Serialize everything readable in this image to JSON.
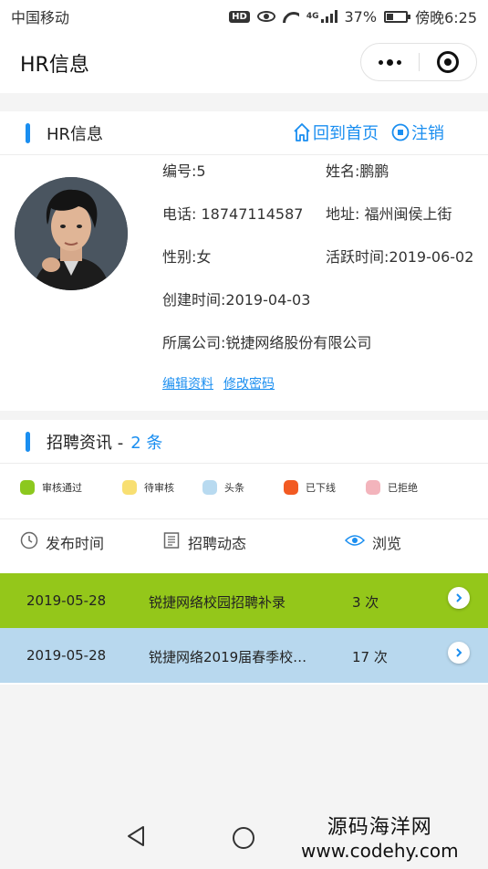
{
  "status_bar": {
    "carrier": "中国移动",
    "hd": "HD",
    "network": "4G",
    "battery": "37%",
    "battery_level": 0.37,
    "time": "傍晚6:25"
  },
  "nav_bar": {
    "title": "HR信息"
  },
  "hr_card": {
    "title": "HR信息",
    "home_action": "回到首页",
    "logout_action": "注销",
    "fields": {
      "id": "编号:5",
      "name": "姓名:鹏鹏",
      "phone": "电话: 18747114587",
      "address": "地址: 福州闽侯上街",
      "gender": "性别:女",
      "active_time": "活跃时间:2019-06-02",
      "created_time": "创建时间:2019-04-03",
      "company": "所属公司:锐捷网络股份有限公司"
    },
    "edit_link": "编辑资料",
    "password_link": "修改密码"
  },
  "recruit": {
    "title": "招聘资讯 -",
    "count": "2 条",
    "legend": [
      {
        "label": "审核通过",
        "color": "#8cc81e"
      },
      {
        "label": "待审核",
        "color": "#f8df72"
      },
      {
        "label": "头条",
        "color": "#b8daf0"
      },
      {
        "label": "已下线",
        "color": "#f25a22"
      },
      {
        "label": "已拒绝",
        "color": "#f3b4bc"
      }
    ],
    "columns": {
      "time": "发布时间",
      "dynamic": "招聘动态",
      "views": "浏览"
    },
    "rows": [
      {
        "date": "2019-05-28",
        "title": "锐捷网络校园招聘补录",
        "views": "3 次",
        "bg": "#94c71a"
      },
      {
        "date": "2019-05-28",
        "title": "锐捷网络2019届春季校…",
        "views": "17 次",
        "bg": "#b8d8ee"
      }
    ]
  },
  "watermark": {
    "line1": "源码海洋网",
    "line2": "www.codehy.com"
  }
}
